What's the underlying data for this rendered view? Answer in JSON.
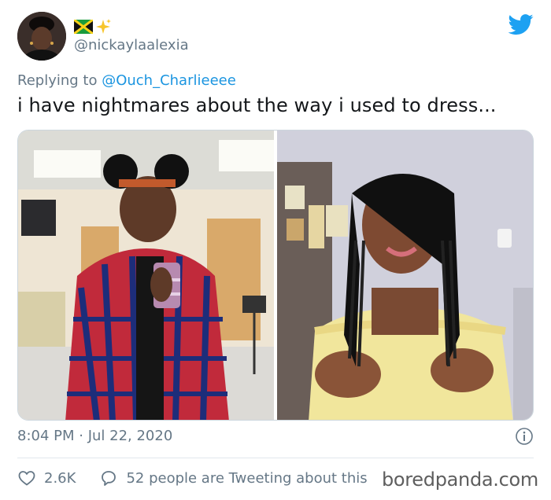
{
  "user": {
    "handle": "@nickaylaalexia",
    "name_emojis": [
      "jamaica-flag",
      "sparkles"
    ]
  },
  "reply": {
    "prefix": "Replying to ",
    "mention": "@Ouch_Charlieeee"
  },
  "tweet": {
    "text": "i have nightmares about the way i used to dress..."
  },
  "media": {
    "photos": [
      {
        "name": "before-photo"
      },
      {
        "name": "after-photo"
      }
    ]
  },
  "meta": {
    "timestamp": "8:04 PM · Jul 22, 2020"
  },
  "actions": {
    "likes": "2.6K",
    "discussion": "52 people are Tweeting about this"
  },
  "watermark": "boredpanda.com",
  "colors": {
    "twitter_blue": "#1da1f2",
    "mention_blue": "#1b95e0",
    "muted_gray": "#657786"
  }
}
